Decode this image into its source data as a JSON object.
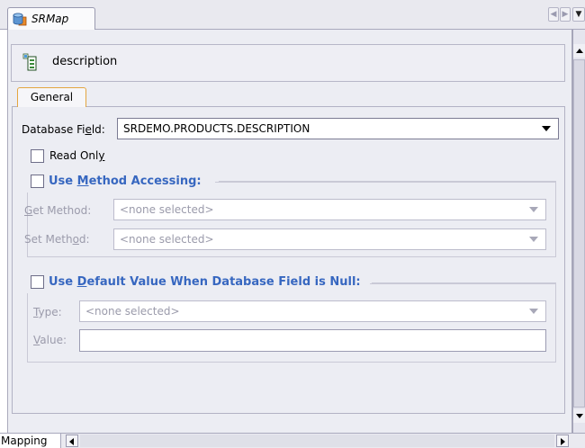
{
  "editor_tab": {
    "title": "SRMap",
    "icon": "database-map-icon"
  },
  "header": {
    "mapping_name": "description",
    "icon": "field-mapping-icon"
  },
  "tabs": {
    "general": "General",
    "bottom": "Mapping"
  },
  "database_field": {
    "label_pre": "Database Fi",
    "label_key": "e",
    "label_post": "ld:",
    "value": "SRDEMO.PRODUCTS.DESCRIPTION"
  },
  "read_only": {
    "label_pre": "Read Onl",
    "label_key": "y",
    "label_post": "",
    "checked": false
  },
  "method_access": {
    "label_pre": "Use ",
    "label_key": "M",
    "label_post": "ethod Accessing:",
    "checked": false,
    "get_label_pre": "",
    "get_label_key": "G",
    "get_label_post": "et Method:",
    "get_value": "<none selected>",
    "set_label_pre": "Set Meth",
    "set_label_key": "o",
    "set_label_post": "d:",
    "set_value": "<none selected>"
  },
  "default_value": {
    "label_pre": "Use ",
    "label_key": "D",
    "label_post": "efault Value When Database Field is Null:",
    "checked": false,
    "type_label_pre": "",
    "type_label_key": "T",
    "type_label_post": "ype:",
    "type_value": "<none selected>",
    "value_label_pre": "",
    "value_label_key": "V",
    "value_label_post": "alue:",
    "value": ""
  },
  "colors": {
    "group_title": "#3767c0",
    "active_tab_border": "#e4a640",
    "panel_bg": "#ecedf3"
  }
}
